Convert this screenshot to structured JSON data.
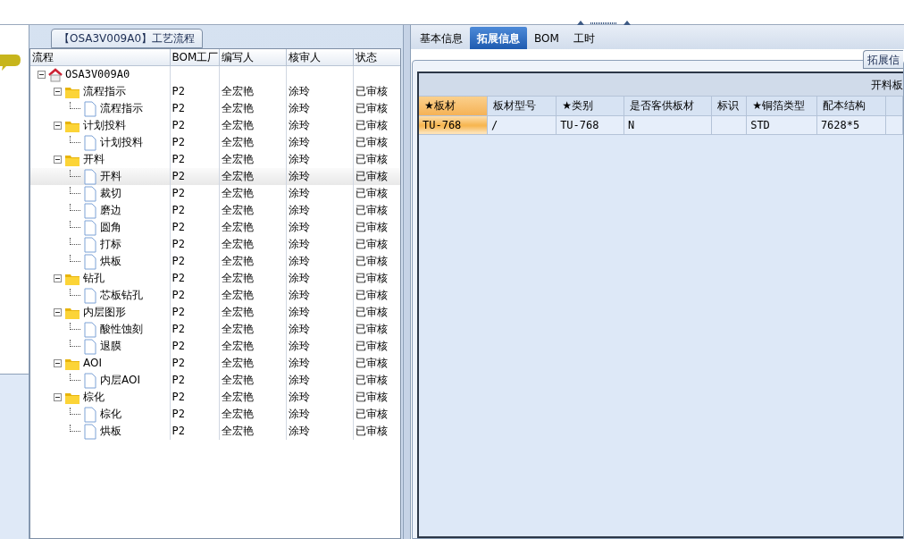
{
  "group_box": {
    "title": "【OSA3V009A0】工艺流程"
  },
  "tree_table": {
    "columns": [
      "流程",
      "BOM工厂",
      "编写人",
      "核审人",
      "状态"
    ],
    "root": {
      "label": "OSA3V009A0",
      "expanded": true,
      "children": [
        {
          "label": "流程指示",
          "factory": "P2",
          "author": "全宏艳",
          "reviewer": "涂玲",
          "status": "已审核",
          "expanded": true,
          "selected": false,
          "children": [
            {
              "label": "流程指示",
              "factory": "P2",
              "author": "全宏艳",
              "reviewer": "涂玲",
              "status": "已审核",
              "selected": false
            }
          ]
        },
        {
          "label": "计划投料",
          "factory": "P2",
          "author": "全宏艳",
          "reviewer": "涂玲",
          "status": "已审核",
          "expanded": true,
          "selected": false,
          "children": [
            {
              "label": "计划投料",
              "factory": "P2",
              "author": "全宏艳",
              "reviewer": "涂玲",
              "status": "已审核",
              "selected": false
            }
          ]
        },
        {
          "label": "开料",
          "factory": "P2",
          "author": "全宏艳",
          "reviewer": "涂玲",
          "status": "已审核",
          "expanded": true,
          "selected": false,
          "children": [
            {
              "label": "开料",
              "factory": "P2",
              "author": "全宏艳",
              "reviewer": "涂玲",
              "status": "已审核",
              "selected": true
            },
            {
              "label": "裁切",
              "factory": "P2",
              "author": "全宏艳",
              "reviewer": "涂玲",
              "status": "已审核",
              "selected": false
            },
            {
              "label": "磨边",
              "factory": "P2",
              "author": "全宏艳",
              "reviewer": "涂玲",
              "status": "已审核",
              "selected": false
            },
            {
              "label": "圆角",
              "factory": "P2",
              "author": "全宏艳",
              "reviewer": "涂玲",
              "status": "已审核",
              "selected": false
            },
            {
              "label": "打标",
              "factory": "P2",
              "author": "全宏艳",
              "reviewer": "涂玲",
              "status": "已审核",
              "selected": false
            },
            {
              "label": "烘板",
              "factory": "P2",
              "author": "全宏艳",
              "reviewer": "涂玲",
              "status": "已审核",
              "selected": false
            }
          ]
        },
        {
          "label": "钻孔",
          "factory": "P2",
          "author": "全宏艳",
          "reviewer": "涂玲",
          "status": "已审核",
          "expanded": true,
          "selected": false,
          "children": [
            {
              "label": "芯板钻孔",
              "factory": "P2",
              "author": "全宏艳",
              "reviewer": "涂玲",
              "status": "已审核",
              "selected": false
            }
          ]
        },
        {
          "label": "内层图形",
          "factory": "P2",
          "author": "全宏艳",
          "reviewer": "涂玲",
          "status": "已审核",
          "expanded": true,
          "selected": false,
          "children": [
            {
              "label": "酸性蚀刻",
              "factory": "P2",
              "author": "全宏艳",
              "reviewer": "涂玲",
              "status": "已审核",
              "selected": false
            },
            {
              "label": "退膜",
              "factory": "P2",
              "author": "全宏艳",
              "reviewer": "涂玲",
              "status": "已审核",
              "selected": false
            }
          ]
        },
        {
          "label": "AOI",
          "factory": "P2",
          "author": "全宏艳",
          "reviewer": "涂玲",
          "status": "已审核",
          "expanded": true,
          "selected": false,
          "children": [
            {
              "label": "内层AOI",
              "factory": "P2",
              "author": "全宏艳",
              "reviewer": "涂玲",
              "status": "已审核",
              "selected": false
            }
          ]
        },
        {
          "label": "棕化",
          "factory": "P2",
          "author": "全宏艳",
          "reviewer": "涂玲",
          "status": "已审核",
          "expanded": true,
          "selected": false,
          "children": [
            {
              "label": "棕化",
              "factory": "P2",
              "author": "全宏艳",
              "reviewer": "涂玲",
              "status": "已审核",
              "selected": false
            },
            {
              "label": "烘板",
              "factory": "P2",
              "author": "全宏艳",
              "reviewer": "涂玲",
              "status": "已审核",
              "selected": false
            }
          ]
        }
      ]
    }
  },
  "tabs": [
    {
      "label": "基本信息",
      "selected": false
    },
    {
      "label": "拓展信息",
      "selected": true
    },
    {
      "label": "BOM",
      "selected": false
    },
    {
      "label": "工时",
      "selected": false
    }
  ],
  "subtab_button": "拓展信",
  "grid": {
    "caption": "开料板",
    "columns": [
      "★板材",
      "板材型号",
      "★类别",
      "是否客供板材",
      "标识",
      "★铜箔类型",
      "配本结构"
    ],
    "rows": [
      {
        "cells": [
          {
            "text": "TU-768",
            "selected": true
          },
          {
            "text": "/",
            "selected": false
          },
          {
            "text": "TU-768",
            "selected": false
          },
          {
            "text": "N",
            "selected": false
          },
          {
            "selected": false
          },
          {
            "text": "STD",
            "selected": false
          },
          {
            "text": "7628*5",
            "selected": false
          }
        ]
      }
    ]
  }
}
